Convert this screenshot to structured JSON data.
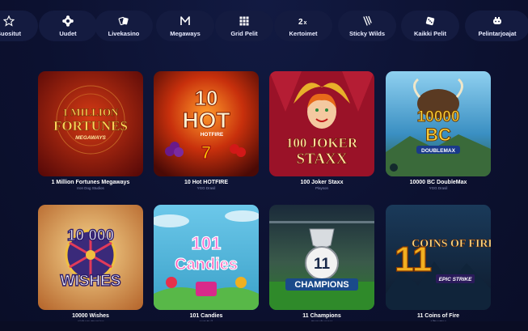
{
  "categories": [
    {
      "label": "Suositut",
      "icon": "star-icon"
    },
    {
      "label": "Uudet",
      "icon": "badge-icon"
    },
    {
      "label": "Livekasino",
      "icon": "cards-icon"
    },
    {
      "label": "Megaways",
      "icon": "megaways-icon"
    },
    {
      "label": "Grid Pelit",
      "icon": "grid-icon"
    },
    {
      "label": "Kertoimet",
      "icon": "multiplier-icon"
    },
    {
      "label": "Sticky Wilds",
      "icon": "claw-icon"
    },
    {
      "label": "Kaikki Pelit",
      "icon": "dice-icon"
    },
    {
      "label": "Pelintarjoajat",
      "icon": "providers-icon"
    }
  ],
  "games": [
    {
      "name": "1 Million Fortunes Megaways",
      "provider": "Iron Dog Studios",
      "art_line1": "1 MILLION",
      "art_line2": "FORTUNES",
      "art_line3": "MEGAWAYS",
      "bg": "#8e1410"
    },
    {
      "name": "10 Hot HOTFIRE",
      "provider": "YGG Drasil",
      "art_line1": "10",
      "art_line2": "HOT",
      "art_line3": "HOTFIRE",
      "bg": "#b5260e"
    },
    {
      "name": "100 Joker Staxx",
      "provider": "Playson",
      "art_line1": "100 JOKER",
      "art_line2": "STAXX",
      "art_line3": "",
      "bg": "#a01028"
    },
    {
      "name": "10000 BC DoubleMax",
      "provider": "YGG Drasil",
      "art_line1": "10000",
      "art_line2": "BC",
      "art_line3": "DOUBLEMAX",
      "bg": "#3a8fc2"
    },
    {
      "name": "10000 Wishes",
      "provider": "AlchemyGaming",
      "art_line1": "10 000",
      "art_line2": "WISHES",
      "art_line3": "",
      "bg": "#d89a4a"
    },
    {
      "name": "101 Candies",
      "provider": "Hot Evil",
      "art_line1": "101",
      "art_line2": "Candies",
      "art_line3": "",
      "bg": "#4cb2d8"
    },
    {
      "name": "11 Champions",
      "provider": "Gamebunger",
      "art_line1": "11",
      "art_line2": "CHAMPIONS",
      "art_line3": "",
      "bg": "#2b6a2a"
    },
    {
      "name": "11 Coins of Fire",
      "provider": "AllForOne",
      "art_line1": "11",
      "art_line2": "COINS OF FIRE",
      "art_line3": "EPIC STRIKE",
      "bg": "#1c3550"
    }
  ]
}
